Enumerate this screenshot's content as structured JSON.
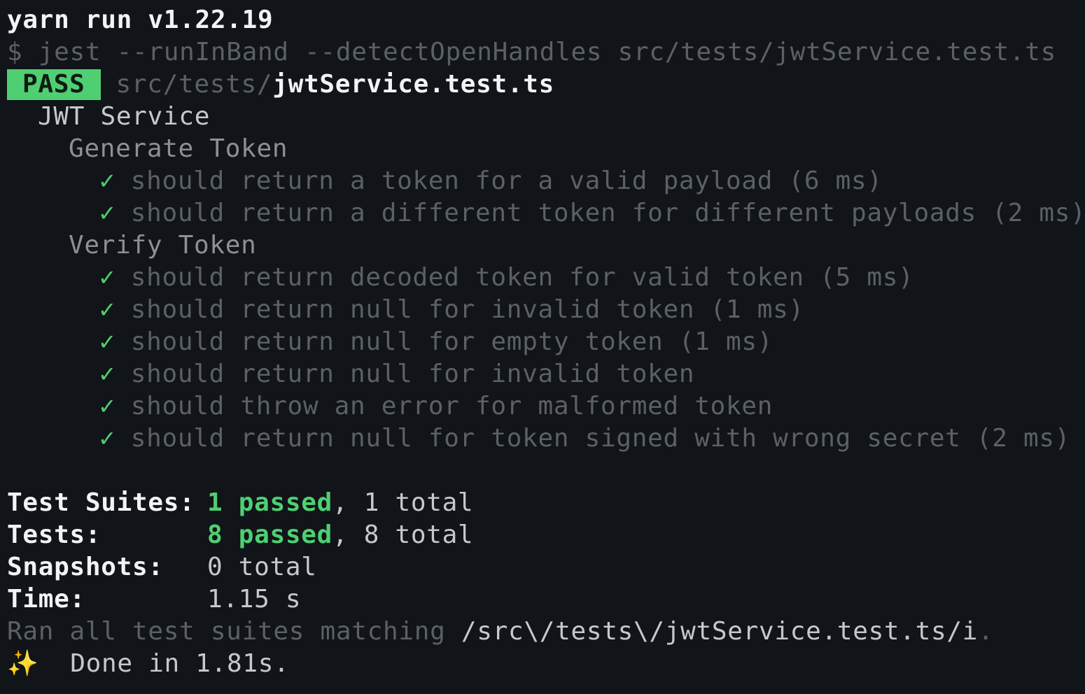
{
  "terminal": {
    "header": "yarn run v1.22.19",
    "command": "$ jest --runInBand --detectOpenHandles src/tests/jwtService.test.ts",
    "result": {
      "badge": "PASS",
      "path_dir": "src/tests/",
      "path_file": "jwtService.test.ts"
    },
    "suite": "JWT Service",
    "groups": [
      {
        "name": "Generate Token",
        "tests": [
          {
            "check": "✓",
            "text": "should return a token for a valid payload (6 ms)"
          },
          {
            "check": "✓",
            "text": "should return a different token for different payloads (2 ms)"
          }
        ]
      },
      {
        "name": "Verify Token",
        "tests": [
          {
            "check": "✓",
            "text": "should return decoded token for valid token (5 ms)"
          },
          {
            "check": "✓",
            "text": "should return null for invalid token (1 ms)"
          },
          {
            "check": "✓",
            "text": "should return null for empty token (1 ms)"
          },
          {
            "check": "✓",
            "text": "should return null for invalid token"
          },
          {
            "check": "✓",
            "text": "should throw an error for malformed token"
          },
          {
            "check": "✓",
            "text": "should return null for token signed with wrong secret (2 ms)"
          }
        ]
      }
    ],
    "summary": {
      "suites_label": "Test Suites:",
      "suites_passed": "1 passed",
      "suites_total": ", 1 total",
      "tests_label": "Tests:",
      "tests_passed": "8 passed",
      "tests_total": ", 8 total",
      "snapshots_label": "Snapshots:",
      "snapshots_value": "0 total",
      "time_label": "Time:",
      "time_value": "1.15 s"
    },
    "ran_prefix": "Ran all test suites matching ",
    "ran_pattern": "/src\\/tests\\/jwtService.test.ts/i",
    "ran_suffix": ".",
    "done_icon": "✨",
    "done_text": "Done in 1.81s."
  },
  "colors": {
    "background": "#111418",
    "pass_green": "#4fcf72",
    "text": "#c5c8cc",
    "dim": "#5b6068"
  }
}
